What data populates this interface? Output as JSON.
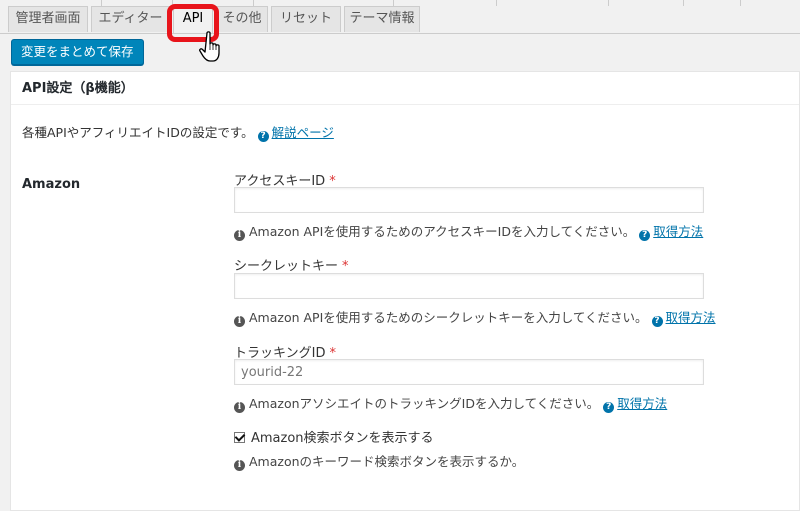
{
  "tabs": [
    {
      "label": "管理者画面"
    },
    {
      "label": "エディター"
    },
    {
      "label": "API"
    },
    {
      "label": "その他"
    },
    {
      "label": "リセット"
    },
    {
      "label": "テーマ情報"
    }
  ],
  "toolbar": {
    "save_label": "変更をまとめて保存"
  },
  "panel": {
    "title": "API設定（β機能）",
    "intro": "各種APIやアフィリエイトIDの設定です。",
    "intro_link": "解説ページ"
  },
  "amazon": {
    "section_label": "Amazon",
    "access_key": {
      "label": "アクセスキーID",
      "required": "*",
      "value": "",
      "description": "Amazon APIを使用するためのアクセスキーIDを入力してください。",
      "link": "取得方法"
    },
    "secret_key": {
      "label": "シークレットキー",
      "required": "*",
      "value": "",
      "description": "Amazon APIを使用するためのシークレットキーを入力してください。",
      "link": "取得方法"
    },
    "tracking_id": {
      "label": "トラッキングID",
      "required": "*",
      "placeholder": "yourid-22",
      "description": "AmazonアソシエイトのトラッキングIDを入力してください。",
      "link": "取得方法"
    },
    "search_button": {
      "label": "Amazon検索ボタンを表示する",
      "checked": true,
      "description": "Amazonのキーワード検索ボタンを表示するか。"
    }
  },
  "colors": {
    "highlight": "#e8141b",
    "primary": "#0085ba",
    "link": "#0073aa"
  }
}
